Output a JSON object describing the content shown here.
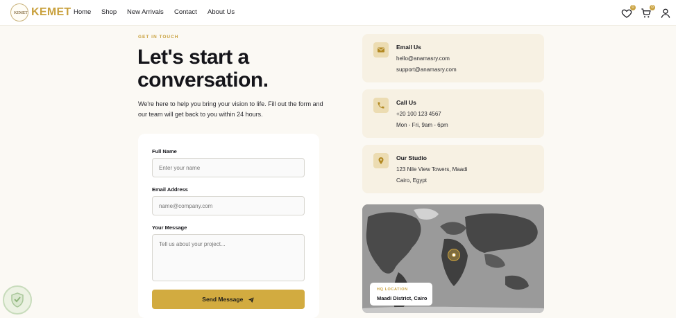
{
  "nav": {
    "logo_text": "KEMET",
    "brand": "KEMET",
    "links": [
      "Home",
      "Shop",
      "New Arrivals",
      "Contact",
      "About Us"
    ],
    "wishlist_count": "0",
    "cart_count": "0"
  },
  "hero": {
    "eyebrow": "GET IN TOUCH",
    "headline_line1": "Let's start a",
    "headline_line2": "conversation.",
    "intro": "We're here to help you bring your vision to life. Fill out the form and our team will get back to you within 24 hours."
  },
  "form": {
    "name_label": "Full Name",
    "name_placeholder": "Enter your name",
    "email_label": "Email Address",
    "email_placeholder": "name@company.com",
    "message_label": "Your Message",
    "message_placeholder": "Tell us about your project...",
    "submit_label": "Send Message"
  },
  "contact_cards": [
    {
      "icon": "mail-icon",
      "title": "Email Us",
      "line1": "hello@anamasry.com",
      "line2": "support@anamasry.com"
    },
    {
      "icon": "phone-icon",
      "title": "Call Us",
      "line1": "+20 100 123 4567",
      "line2": "Mon - Fri, 9am - 6pm"
    },
    {
      "icon": "map-pin-icon",
      "title": "Our Studio",
      "line1": "123 Nile View Towers, Maadi",
      "line2": "Cairo, Egypt"
    }
  ],
  "map": {
    "location_label": "HQ LOCATION",
    "location_value": "Maadi District, Cairo"
  },
  "colors": {
    "accent": "#c9a13e",
    "button": "#d2ab40",
    "card_bg": "#f7f1e3",
    "page_bg": "#fbf9f4"
  }
}
